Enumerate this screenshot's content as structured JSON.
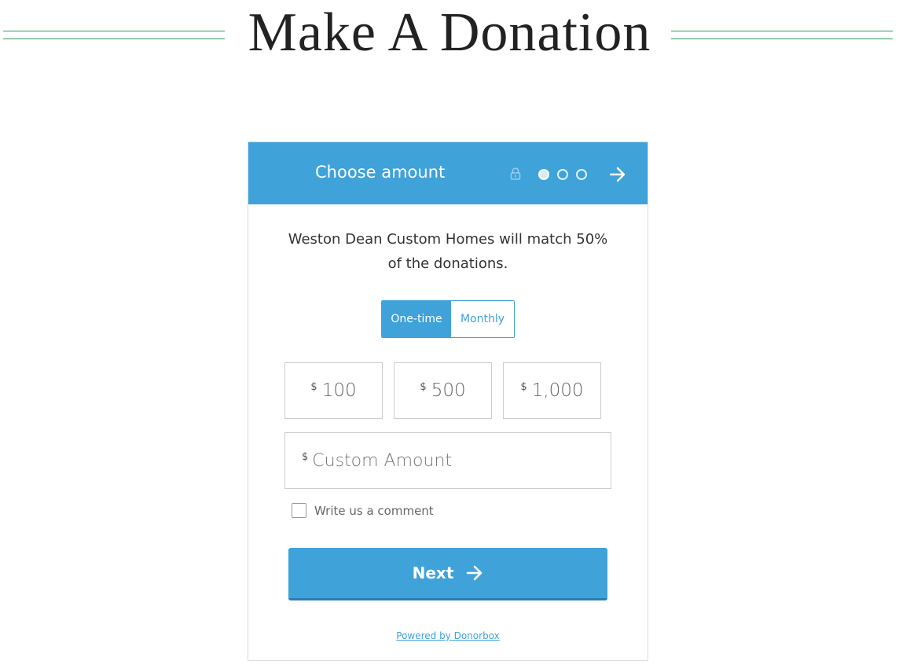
{
  "heading": {
    "title": "Make A Donation",
    "rule_color": "#2f9a5b"
  },
  "widget": {
    "accent_color": "#3fa2d9",
    "header": {
      "title": "Choose amount",
      "icons": [
        "lock-icon",
        "step-dot-active",
        "step-dot",
        "step-dot",
        "arrow-right-icon"
      ],
      "step_current": 1,
      "step_total": 3
    },
    "match_text": "Weston Dean Custom Homes will match 50% of the donations.",
    "frequency": {
      "options": [
        "One-time",
        "Monthly"
      ],
      "selected": "One-time"
    },
    "currency_symbol": "$",
    "amounts": [
      "100",
      "500",
      "1,000"
    ],
    "custom_amount": {
      "placeholder": "Custom Amount",
      "value": ""
    },
    "comment_label": "Write us a comment",
    "comment_checked": false,
    "next_label": "Next",
    "powered_by": "Powered by Donorbox"
  }
}
